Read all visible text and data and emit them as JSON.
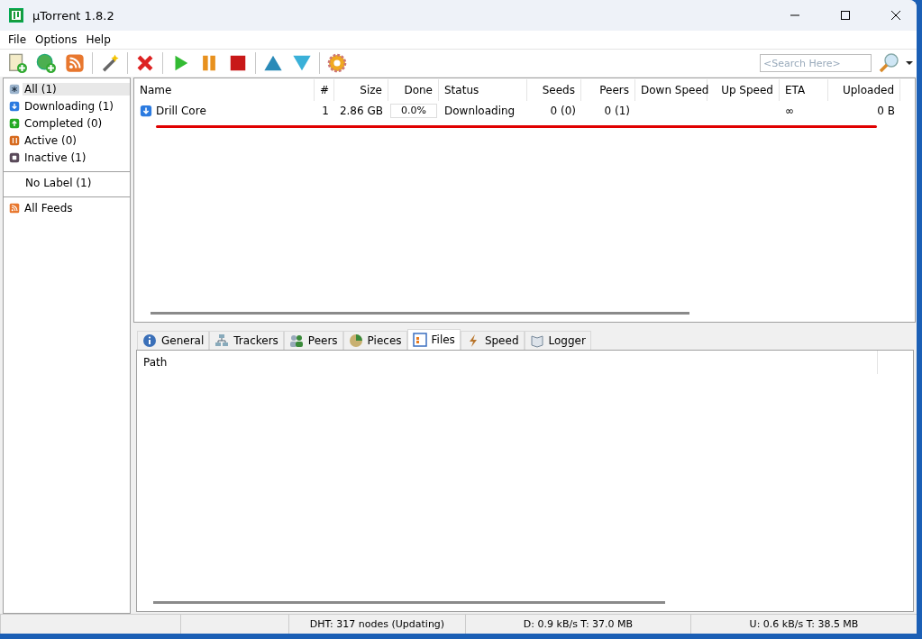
{
  "window": {
    "title": "µTorrent 1.8.2"
  },
  "menu": [
    "File",
    "Options",
    "Help"
  ],
  "toolbar": [
    {
      "kind": "add-file"
    },
    {
      "kind": "add-url"
    },
    {
      "kind": "rss"
    },
    {
      "kind": "sep"
    },
    {
      "kind": "wand"
    },
    {
      "kind": "sep"
    },
    {
      "kind": "remove"
    },
    {
      "kind": "sep"
    },
    {
      "kind": "start"
    },
    {
      "kind": "pause"
    },
    {
      "kind": "stop"
    },
    {
      "kind": "sep"
    },
    {
      "kind": "up"
    },
    {
      "kind": "down"
    },
    {
      "kind": "sep"
    },
    {
      "kind": "settings"
    }
  ],
  "search": {
    "placeholder": "<Search Here>"
  },
  "sidebar": {
    "groups": [
      [
        {
          "label": "All (1)",
          "kind": "all",
          "selected": true
        },
        {
          "label": "Downloading (1)",
          "kind": "downloading",
          "selected": false
        },
        {
          "label": "Completed (0)",
          "kind": "completed",
          "selected": false
        },
        {
          "label": "Active (0)",
          "kind": "active",
          "selected": false
        },
        {
          "label": "Inactive (1)",
          "kind": "inactive",
          "selected": false
        }
      ],
      [
        {
          "label": "No Label (1)",
          "kind": "label",
          "selected": false
        }
      ],
      [
        {
          "label": "All Feeds",
          "kind": "feeds",
          "selected": false
        }
      ]
    ]
  },
  "table": {
    "columns": [
      "Name",
      "#",
      "Size",
      "Done",
      "Status",
      "Seeds",
      "Peers",
      "Down Speed",
      "Up Speed",
      "ETA",
      "Uploaded"
    ],
    "rows": [
      {
        "name": "Drill Core",
        "number": "1",
        "size": "2.86 GB",
        "done": "0.0%",
        "level": 0,
        "status": "Downloading",
        "seeds": "0 (0)",
        "peers": "0 (1)",
        "eta": "∞",
        "uploaded": "0 B"
      }
    ]
  },
  "detail_tabs": [
    {
      "label": "General",
      "kind": "info",
      "selected": false
    },
    {
      "label": "Trackers",
      "kind": "network",
      "selected": false
    },
    {
      "label": "Peers",
      "kind": "people",
      "selected": false
    },
    {
      "label": "Pieces",
      "kind": "pieces",
      "selected": false
    },
    {
      "label": "Files",
      "kind": "files",
      "selected": true
    },
    {
      "label": "Speed",
      "kind": "speed",
      "selected": false
    },
    {
      "label": "Logger",
      "kind": "book",
      "selected": false
    }
  ],
  "files_table": {
    "columns": [
      "Path"
    ]
  },
  "status_bar": [
    "DHT: 317 nodes (Updating)",
    "D: 0.9 kB/s T: 37.0 MB",
    "U: 0.6 kB/s T: 38.5 MB"
  ]
}
